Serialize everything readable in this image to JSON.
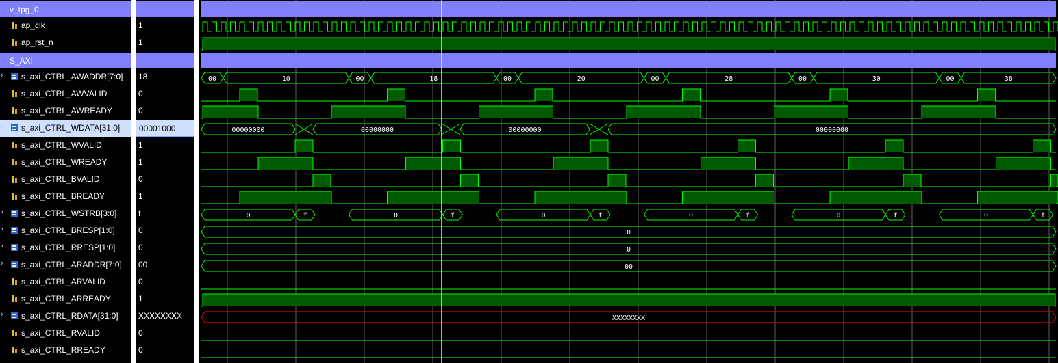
{
  "signals": [
    {
      "name": "v_tpg_0",
      "value": "",
      "kind": "group"
    },
    {
      "name": "ap_clk",
      "value": "1",
      "kind": "bit"
    },
    {
      "name": "ap_rst_n",
      "value": "1",
      "kind": "bit"
    },
    {
      "name": "S_AXI",
      "value": "",
      "kind": "group"
    },
    {
      "name": "s_axi_CTRL_AWADDR[7:0]",
      "value": "18",
      "kind": "bus",
      "expandable": true
    },
    {
      "name": "s_axi_CTRL_AWVALID",
      "value": "0",
      "kind": "bit"
    },
    {
      "name": "s_axi_CTRL_AWREADY",
      "value": "0",
      "kind": "bit"
    },
    {
      "name": "s_axi_CTRL_WDATA[31:0]",
      "value": "00001000",
      "kind": "bus",
      "expandable": true,
      "selected": true
    },
    {
      "name": "s_axi_CTRL_WVALID",
      "value": "1",
      "kind": "bit"
    },
    {
      "name": "s_axi_CTRL_WREADY",
      "value": "1",
      "kind": "bit"
    },
    {
      "name": "s_axi_CTRL_BVALID",
      "value": "0",
      "kind": "bit"
    },
    {
      "name": "s_axi_CTRL_BREADY",
      "value": "1",
      "kind": "bit"
    },
    {
      "name": "s_axi_CTRL_WSTRB[3:0]",
      "value": "f",
      "kind": "bus",
      "expandable": true
    },
    {
      "name": "s_axi_CTRL_BRESP[1:0]",
      "value": "0",
      "kind": "bus",
      "expandable": true
    },
    {
      "name": "s_axi_CTRL_RRESP[1:0]",
      "value": "0",
      "kind": "bus",
      "expandable": true
    },
    {
      "name": "s_axi_CTRL_ARADDR[7:0]",
      "value": "00",
      "kind": "bus",
      "expandable": true
    },
    {
      "name": "s_axi_CTRL_ARVALID",
      "value": "0",
      "kind": "bit"
    },
    {
      "name": "s_axi_CTRL_ARREADY",
      "value": "1",
      "kind": "bit"
    },
    {
      "name": "s_axi_CTRL_RDATA[31:0]",
      "value": "XXXXXXXX",
      "kind": "bus",
      "expandable": true
    },
    {
      "name": "s_axi_CTRL_RVALID",
      "value": "0",
      "kind": "bit"
    },
    {
      "name": "s_axi_CTRL_RREADY",
      "value": "0",
      "kind": "bit"
    }
  ],
  "bus_labels": {
    "awaddr": [
      "00",
      "10",
      "00",
      "18",
      "00",
      "20",
      "00",
      "28",
      "00",
      "30",
      "00",
      "38"
    ],
    "wdata": [
      "00000000",
      "00000000",
      "00000000",
      "00000000"
    ],
    "wstrb": [
      "0",
      "f",
      "0",
      "f",
      "0",
      "f",
      "0",
      "f",
      "0",
      "f",
      "0",
      "f"
    ],
    "bresp": "0",
    "rresp": "0",
    "araddr": "00",
    "rdata": "XXXXXXXX"
  },
  "colors": {
    "group": "#8080ff",
    "wave": "#00ff00",
    "fill": "#005a00",
    "cursor": "#ffff00",
    "undefined": "#ff0000",
    "selected": "#cfe0ff"
  }
}
